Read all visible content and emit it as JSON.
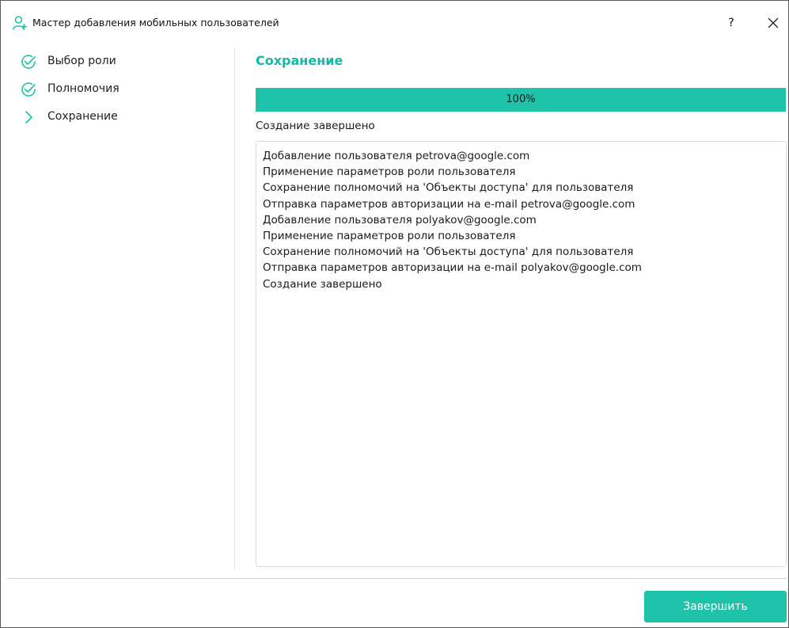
{
  "window": {
    "title": "Мастер добавления мобильных пользователей",
    "icon": "user-add-icon",
    "help_label": "?"
  },
  "steps": [
    {
      "label": "Выбор роли",
      "state": "done",
      "icon": "check-circle-icon"
    },
    {
      "label": "Полномочия",
      "state": "done",
      "icon": "check-circle-icon"
    },
    {
      "label": "Сохранение",
      "state": "current",
      "icon": "chevron-right-icon"
    }
  ],
  "main": {
    "section_title": "Сохранение",
    "progress": {
      "value": 100,
      "label": "100%"
    },
    "status_label": "Создание завершено",
    "log_lines": [
      "Добавление пользователя petrova@google.com",
      "Применение параметров роли пользователя",
      "Сохранение полномочий на 'Объекты доступа' для пользователя",
      "Отправка параметров авторизации на e-mail petrova@google.com",
      "Добавление пользователя polyakov@google.com",
      "Применение параметров роли пользователя",
      "Сохранение полномочий на 'Объекты доступа' для пользователя",
      "Отправка параметров авторизации на e-mail polyakov@google.com",
      "Создание завершено"
    ]
  },
  "footer": {
    "finish_label": "Завершить"
  },
  "colors": {
    "accent": "#1ec3a9",
    "accent_text": "#14b8a6"
  }
}
